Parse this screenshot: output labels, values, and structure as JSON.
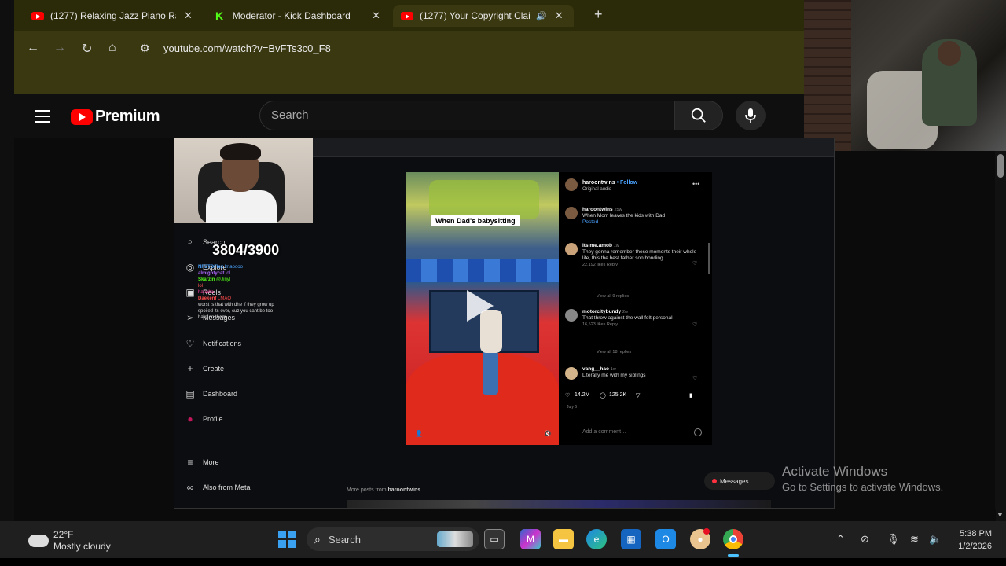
{
  "browser": {
    "tabs": [
      {
        "label": "(1277) Relaxing Jazz Piano Radi",
        "icon": "youtube-icon"
      },
      {
        "label": "Moderator - Kick Dashboard",
        "icon": "kick-icon"
      },
      {
        "label": "(1277) Your Copyright Claim",
        "icon": "youtube-icon",
        "active": true
      }
    ],
    "url": "youtube.com/watch?v=BvFTs3c0_F8"
  },
  "youtube": {
    "brand": "Premium",
    "search_placeholder": "Search"
  },
  "video": {
    "sub_count": "3804/3900",
    "ig_nav": [
      {
        "label": "Search",
        "icon": "search-icon"
      },
      {
        "label": "Explore",
        "icon": "compass-icon"
      },
      {
        "label": "Reels",
        "icon": "reels-icon"
      },
      {
        "label": "Messages",
        "icon": "messages-icon"
      },
      {
        "label": "Notifications",
        "icon": "heart-icon"
      },
      {
        "label": "Create",
        "icon": "plus-icon"
      },
      {
        "label": "Dashboard",
        "icon": "dashboard-icon"
      },
      {
        "label": "Profile",
        "icon": "profile-icon"
      },
      {
        "label": "More",
        "icon": "menu-icon"
      },
      {
        "label": "Also from Meta",
        "icon": "meta-icon"
      }
    ],
    "chat": [
      {
        "user": "NFSTOFlex",
        "text": "lmaoooo",
        "color": "#4aa3ff"
      },
      {
        "user": "almightycat",
        "text": "lol",
        "color": "#b06bff"
      },
      {
        "user": "Skarzin",
        "text": "@Jinyl",
        "color": "#53fc18"
      },
      {
        "user": "",
        "text": "lol",
        "color": "#ff5a5a"
      },
      {
        "user": "",
        "text": "hahaha",
        "color": "#ff3ea5"
      },
      {
        "user": "Daekenf",
        "text": "LMAO",
        "color": "#ff4b4b"
      },
      {
        "user": "",
        "text": "worst is that with dhe if they grow up",
        "color": "#ddd"
      },
      {
        "user": "",
        "text": "spoiled its over, cuz you cant be too",
        "color": "#ddd"
      },
      {
        "user": "",
        "text": "hard on them",
        "color": "#ddd"
      }
    ],
    "reel_caption": "When Dad's babysitting",
    "post": {
      "author": "haroontwins",
      "follow": "• Follow",
      "audio": "Original audio",
      "caption_user": "haroontwins",
      "caption_time": "25w",
      "caption_text": "When Mom leaves the kids with Dad",
      "caption_link": "Posted",
      "comments": [
        {
          "user": "its.me.amob",
          "time": "1w",
          "text": "They gonna remember these moments their whole life, this the best father son bonding",
          "meta": "22,192 likes   Reply",
          "replies": "View all 9 replies"
        },
        {
          "user": "motorcitybundy",
          "time": "2w",
          "text": "That throw against the wall felt personal",
          "meta": "16,523 likes   Reply",
          "replies": "View all 18 replies"
        },
        {
          "user": "vang__hao",
          "time": "1w",
          "text": "Literally me with my siblings",
          "meta": "",
          "replies": ""
        }
      ],
      "likes": "14.2M",
      "comment_count": "125.2K",
      "date": "July 6",
      "add_comment": "Add a comment…"
    },
    "more_posts_prefix": "More posts from",
    "more_posts_user": "haroontwins",
    "messages_label": "Messages"
  },
  "activate_windows": {
    "title": "Activate Windows",
    "subtitle": "Go to Settings to activate Windows."
  },
  "taskbar": {
    "temperature": "22°F",
    "condition": "Mostly cloudy",
    "search": "Search",
    "time": "5:38 PM",
    "date": "1/2/2026"
  }
}
